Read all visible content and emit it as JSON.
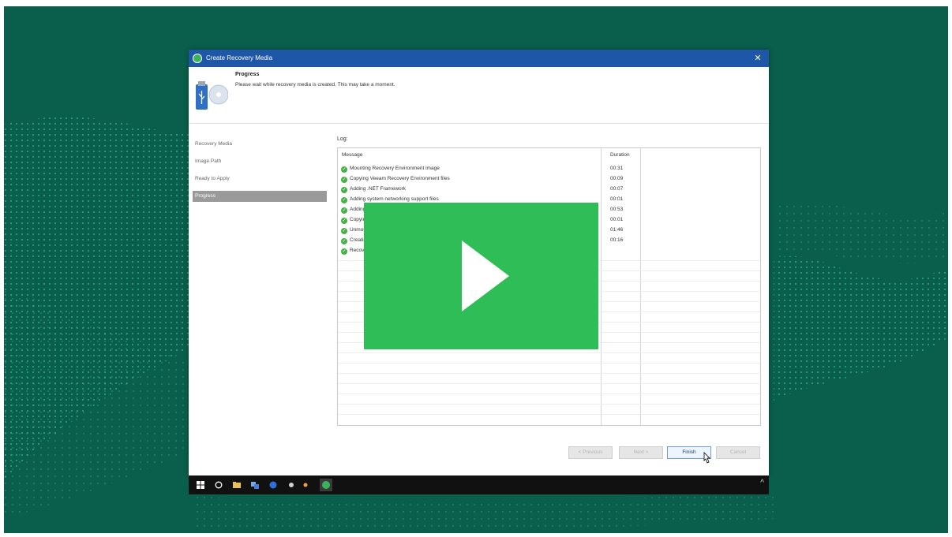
{
  "window": {
    "title": "Create Recovery Media",
    "close_glyph": "✕"
  },
  "header": {
    "title": "Progress",
    "description": "Please wait while recovery media is created. This may take a moment."
  },
  "sidebar": {
    "items": [
      {
        "label": "Recovery Media",
        "active": false
      },
      {
        "label": "Image Path",
        "active": false
      },
      {
        "label": "Ready to Apply",
        "active": false
      },
      {
        "label": "Progress",
        "active": true
      }
    ]
  },
  "log": {
    "label": "Log:",
    "columns": {
      "message": "Message",
      "duration": "Duration"
    },
    "rows": [
      {
        "message": "Mounting Recovery Environment image",
        "duration": "00:31"
      },
      {
        "message": "Copying Veeam Recovery Environment files",
        "duration": "00:09"
      },
      {
        "message": "Adding .NET Framework",
        "duration": "00:07"
      },
      {
        "message": "Adding system networking support files",
        "duration": "00:01"
      },
      {
        "message": "Adding system drivers",
        "duration": "00:53"
      },
      {
        "message": "Copying boot files",
        "duration": "00:01"
      },
      {
        "message": "Unmounting recovery image",
        "duration": "01:46"
      },
      {
        "message": "Creating ISO image",
        "duration": "00:16"
      },
      {
        "message": "Recovery media has been created",
        "duration": ""
      }
    ]
  },
  "footer": {
    "previous_label": "< Previous",
    "next_label": "Next >",
    "finish_label": "Finish",
    "cancel_label": "Cancel"
  },
  "taskbar": {
    "chevron": "^"
  },
  "colors": {
    "background": "#0a5f4c",
    "titlebar": "#1f57a8",
    "play_overlay": "#2fbd58",
    "success": "#46b046"
  }
}
